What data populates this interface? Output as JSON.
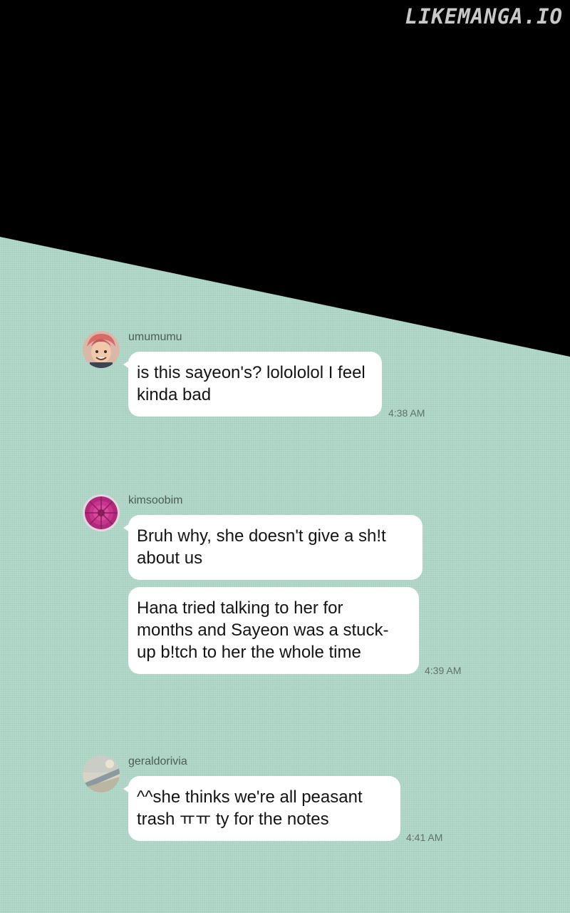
{
  "watermark": "LIKEMANGA.IO",
  "colors": {
    "chat_background": "#a9d2c2",
    "top_background": "#000000",
    "bubble": "#ffffff"
  },
  "messages": [
    {
      "username": "umumumu",
      "avatar_icon": "pink-haired-character-avatar",
      "bubbles": [
        {
          "lines": [
            "is this sayeon's? lolololol I feel",
            "kinda bad"
          ]
        }
      ],
      "time": "4:38 AM"
    },
    {
      "username": "kimsoobim",
      "avatar_icon": "pink-flower-avatar",
      "bubbles": [
        {
          "lines": [
            "Bruh why, she doesn't give a sh!t",
            "about us"
          ]
        },
        {
          "lines": [
            "Hana tried talking to her for",
            "months and Sayeon was a stuck-",
            "up b!tch to her the whole time"
          ]
        }
      ],
      "time": "4:39 AM"
    },
    {
      "username": "geraldorivia",
      "avatar_icon": "airplane-wing-sky-avatar",
      "bubbles": [
        {
          "lines": [
            "^^she thinks we're all peasant",
            "trash ㅠㅠ ty for the notes"
          ]
        }
      ],
      "time": "4:41 AM"
    }
  ]
}
